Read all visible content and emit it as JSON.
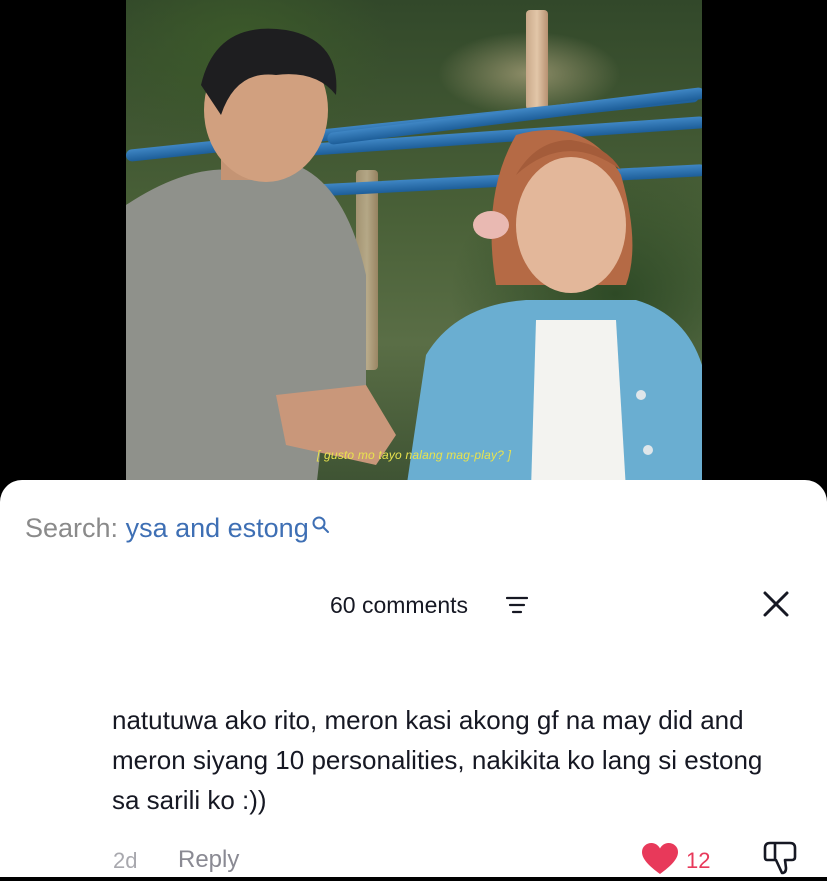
{
  "video": {
    "subtitle": "[ gusto mo tayo nalang mag-play? ]"
  },
  "search": {
    "label": "Search:",
    "query": "ysa and estong"
  },
  "comments": {
    "count_label": "60 comments"
  },
  "comment": {
    "text": "natutuwa ako rito, meron kasi akong gf na may did and meron siyang 10 personalities, nakikita ko lang si estong sa sarili ko :))",
    "time": "2d",
    "reply_label": "Reply",
    "likes": "12"
  },
  "colors": {
    "accent_like": "#e8395a",
    "search_query": "#3e6fb4"
  },
  "icons": [
    "search-icon",
    "filter-icon",
    "close-icon",
    "heart-icon",
    "dislike-icon"
  ]
}
